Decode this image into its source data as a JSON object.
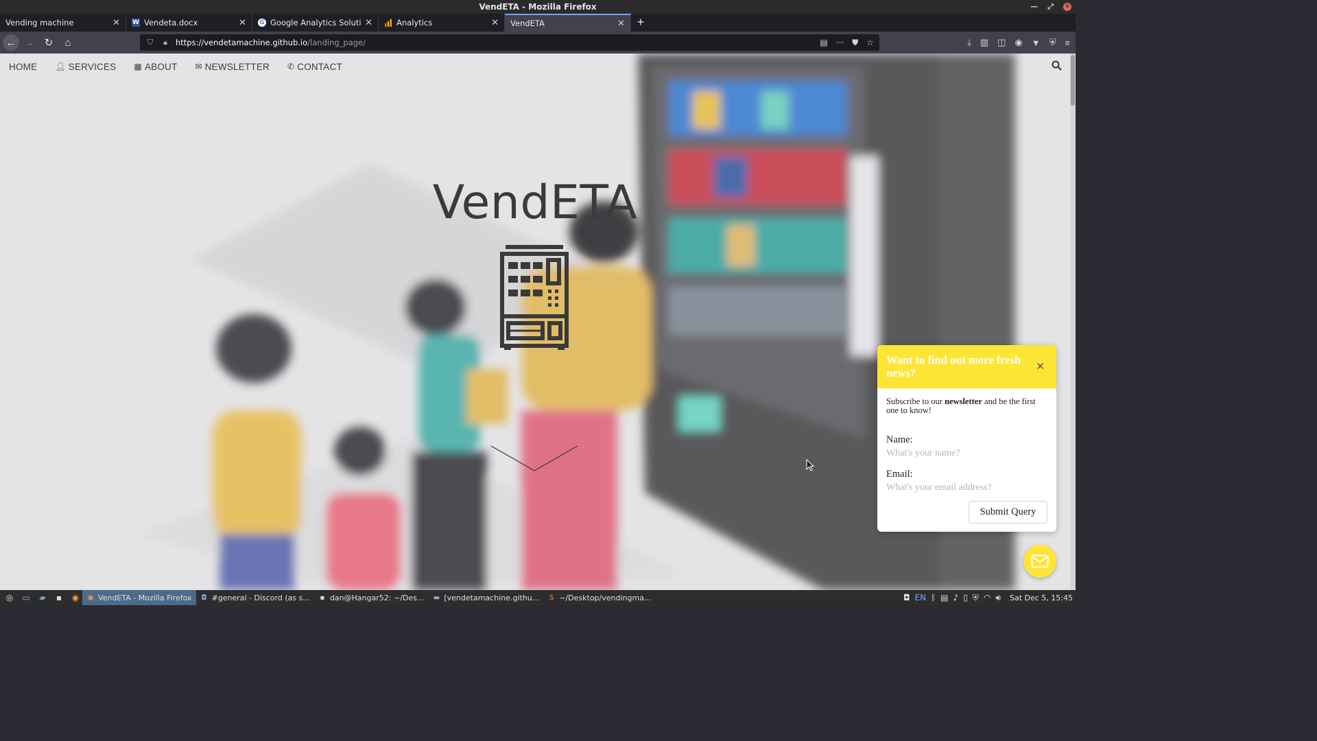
{
  "window": {
    "title": "VendETA - Mozilla Firefox"
  },
  "tabs": [
    {
      "label": "Vending machine",
      "icon": "none"
    },
    {
      "label": "Vendeta.docx",
      "icon": "word-icon"
    },
    {
      "label": "Google Analytics Solutions",
      "icon": "google-icon"
    },
    {
      "label": "Analytics",
      "icon": "analytics-icon"
    },
    {
      "label": "VendETA",
      "icon": "none",
      "active": true
    }
  ],
  "urlbar": {
    "host": "https://vendetamachine.github.io",
    "path": "/landing_page/"
  },
  "site_nav": {
    "home": "HOME",
    "services": "SERVICES",
    "about": "ABOUT",
    "newsletter": "NEWSLETTER",
    "contact": "CONTACT"
  },
  "hero": {
    "title": "VendETA"
  },
  "popup": {
    "heading": "Want to find out more fresh news?",
    "text_before": "Subscribe to our ",
    "text_bold": "newsletter",
    "text_after": " and be the first one to know!",
    "name_label": "Name:",
    "name_placeholder": "What's your name?",
    "email_label": "Email:",
    "email_placeholder": "What's your email address?",
    "submit": "Submit Query",
    "accent": "#fde535"
  },
  "taskbar": {
    "tasks": [
      {
        "label": "VendETA - Mozilla Firefox",
        "active": true
      },
      {
        "label": "#general - Discord (as s..."
      },
      {
        "label": "dan@Hangar52: ~/Des..."
      },
      {
        "label": "[vendetamachine.githu..."
      },
      {
        "label": "~/Desktop/vendingma..."
      }
    ],
    "lang": "EN",
    "clock": "Sat Dec 5, 15:45"
  }
}
